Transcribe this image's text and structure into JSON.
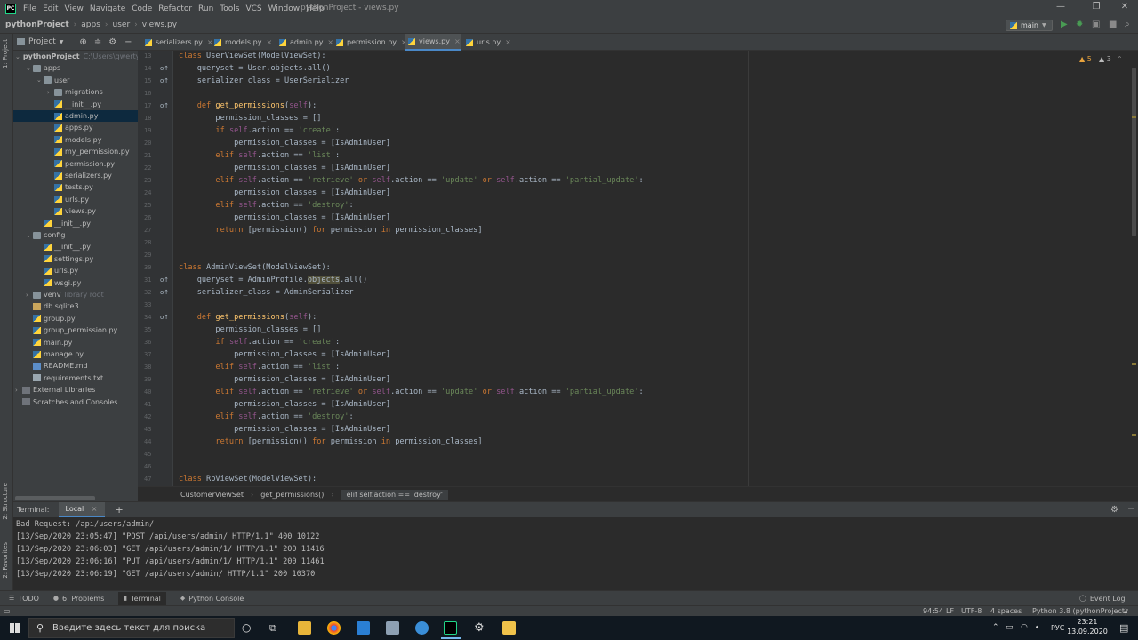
{
  "menubar": {
    "logo": "PC",
    "items": [
      "File",
      "Edit",
      "View",
      "Navigate",
      "Code",
      "Refactor",
      "Run",
      "Tools",
      "VCS",
      "Window",
      "Help"
    ],
    "window_title": "pythonProject - views.py",
    "window_controls": [
      "—",
      "❐",
      "✕"
    ]
  },
  "navbar": {
    "breadcrumbs": [
      "pythonProject",
      "apps",
      "user",
      "views.py"
    ],
    "branch": "main"
  },
  "left_strip": {
    "project_label": "1: Project",
    "structure_label": "2: Structure",
    "favorites_label": "2: Favorites"
  },
  "project_panel": {
    "title": "Project",
    "tree": [
      {
        "label": "pythonProject",
        "hint": "C:\\Users\\qwerty",
        "indent": 0,
        "type": "folder",
        "arrow": "⌄",
        "bold": true
      },
      {
        "label": "apps",
        "indent": 1,
        "type": "folder",
        "arrow": "⌄"
      },
      {
        "label": "user",
        "indent": 2,
        "type": "folder",
        "arrow": "⌄"
      },
      {
        "label": "migrations",
        "indent": 3,
        "type": "folder",
        "arrow": "›"
      },
      {
        "label": "__init__.py",
        "indent": 3,
        "type": "py"
      },
      {
        "label": "admin.py",
        "indent": 3,
        "type": "py",
        "selected": true
      },
      {
        "label": "apps.py",
        "indent": 3,
        "type": "py"
      },
      {
        "label": "models.py",
        "indent": 3,
        "type": "py"
      },
      {
        "label": "my_permission.py",
        "indent": 3,
        "type": "py"
      },
      {
        "label": "permission.py",
        "indent": 3,
        "type": "py"
      },
      {
        "label": "serializers.py",
        "indent": 3,
        "type": "py"
      },
      {
        "label": "tests.py",
        "indent": 3,
        "type": "py"
      },
      {
        "label": "urls.py",
        "indent": 3,
        "type": "py"
      },
      {
        "label": "views.py",
        "indent": 3,
        "type": "py"
      },
      {
        "label": "__init__.py",
        "indent": 2,
        "type": "py"
      },
      {
        "label": "config",
        "indent": 1,
        "type": "folder",
        "arrow": "⌄"
      },
      {
        "label": "__init__.py",
        "indent": 2,
        "type": "py"
      },
      {
        "label": "settings.py",
        "indent": 2,
        "type": "py"
      },
      {
        "label": "urls.py",
        "indent": 2,
        "type": "py"
      },
      {
        "label": "wsgi.py",
        "indent": 2,
        "type": "py"
      },
      {
        "label": "venv",
        "hint": "library root",
        "indent": 1,
        "type": "folder",
        "arrow": "›"
      },
      {
        "label": "db.sqlite3",
        "indent": 1,
        "type": "db"
      },
      {
        "label": "group.py",
        "indent": 1,
        "type": "py"
      },
      {
        "label": "group_permission.py",
        "indent": 1,
        "type": "py"
      },
      {
        "label": "main.py",
        "indent": 1,
        "type": "py"
      },
      {
        "label": "manage.py",
        "indent": 1,
        "type": "py"
      },
      {
        "label": "README.md",
        "indent": 1,
        "type": "md"
      },
      {
        "label": "requirements.txt",
        "indent": 1,
        "type": "file"
      },
      {
        "label": "External Libraries",
        "indent": 0,
        "type": "lib",
        "arrow": "›"
      },
      {
        "label": "Scratches and Consoles",
        "indent": 0,
        "type": "lib"
      }
    ]
  },
  "tabs": [
    {
      "label": "serializers.py"
    },
    {
      "label": "models.py"
    },
    {
      "label": "admin.py"
    },
    {
      "label": "permission.py"
    },
    {
      "label": "views.py",
      "active": true
    },
    {
      "label": "urls.py"
    }
  ],
  "editor": {
    "inspections": {
      "warnings": "5",
      "weak_warnings": "3"
    },
    "lines": [
      {
        "n": "13",
        "marker": "",
        "html": "<span class=\"kw\">class </span>UserViewSet(ModelViewSet):"
      },
      {
        "n": "14",
        "marker": "o↑",
        "html": "    queryset = User.objects.all()"
      },
      {
        "n": "15",
        "marker": "o↑",
        "html": "    serializer_class = UserSerializer"
      },
      {
        "n": "16",
        "marker": "",
        "html": ""
      },
      {
        "n": "17",
        "marker": "o↑",
        "html": "    <span class=\"kw\">def </span><span class=\"fn\">get_permissions</span>(<span class=\"self\">self</span>):"
      },
      {
        "n": "18",
        "marker": "",
        "html": "        permission_classes = []"
      },
      {
        "n": "19",
        "marker": "",
        "html": "        <span class=\"kw\">if </span><span class=\"self\">self</span>.action == <span class=\"str\">'create'</span>:"
      },
      {
        "n": "20",
        "marker": "",
        "html": "            permission_classes = [IsAdminUser]"
      },
      {
        "n": "21",
        "marker": "",
        "html": "        <span class=\"kw\">elif </span><span class=\"self\">self</span>.action == <span class=\"str\">'list'</span>:"
      },
      {
        "n": "22",
        "marker": "",
        "html": "            permission_classes = [IsAdminUser]"
      },
      {
        "n": "23",
        "marker": "",
        "html": "        <span class=\"kw\">elif </span><span class=\"self\">self</span>.action == <span class=\"str\">'retrieve'</span> <span class=\"kw\">or </span><span class=\"self\">self</span>.action == <span class=\"str\">'update'</span> <span class=\"kw\">or </span><span class=\"self\">self</span>.action == <span class=\"str\">'partial_update'</span>:"
      },
      {
        "n": "24",
        "marker": "",
        "html": "            permission_classes = [IsAdminUser]"
      },
      {
        "n": "25",
        "marker": "",
        "html": "        <span class=\"kw\">elif </span><span class=\"self\">self</span>.action == <span class=\"str\">'destroy'</span>:"
      },
      {
        "n": "26",
        "marker": "",
        "html": "            permission_classes = [IsAdminUser]"
      },
      {
        "n": "27",
        "marker": "",
        "html": "        <span class=\"kw\">return </span>[permission() <span class=\"kw\">for </span>permission <span class=\"kw\">in </span>permission_classes]"
      },
      {
        "n": "28",
        "marker": "",
        "html": ""
      },
      {
        "n": "29",
        "marker": "",
        "html": ""
      },
      {
        "n": "30",
        "marker": "",
        "html": "<span class=\"kw\">class </span>AdminViewSet(ModelViewSet):"
      },
      {
        "n": "31",
        "marker": "o↑",
        "html": "    queryset = AdminProfile.<span class=\"hl\">objects</span>.all()"
      },
      {
        "n": "32",
        "marker": "o↑",
        "html": "    serializer_class = AdminSerializer"
      },
      {
        "n": "33",
        "marker": "",
        "html": ""
      },
      {
        "n": "34",
        "marker": "o↑",
        "html": "    <span class=\"kw\">def </span><span class=\"fn\">get_permissions</span>(<span class=\"self\">self</span>):"
      },
      {
        "n": "35",
        "marker": "",
        "html": "        permission_classes = []"
      },
      {
        "n": "36",
        "marker": "",
        "html": "        <span class=\"kw\">if </span><span class=\"self\">self</span>.action == <span class=\"str\">'create'</span>:"
      },
      {
        "n": "37",
        "marker": "",
        "html": "            permission_classes = [IsAdminUser]"
      },
      {
        "n": "38",
        "marker": "",
        "html": "        <span class=\"kw\">elif </span><span class=\"self\">self</span>.action == <span class=\"str\">'list'</span>:"
      },
      {
        "n": "39",
        "marker": "",
        "html": "            permission_classes = [IsAdminUser]"
      },
      {
        "n": "40",
        "marker": "",
        "html": "        <span class=\"kw\">elif </span><span class=\"self\">self</span>.action == <span class=\"str\">'retrieve'</span> <span class=\"kw\">or </span><span class=\"self\">self</span>.action == <span class=\"str\">'update'</span> <span class=\"kw\">or </span><span class=\"self\">self</span>.action == <span class=\"str\">'partial_update'</span>:"
      },
      {
        "n": "41",
        "marker": "",
        "html": "            permission_classes = [IsAdminUser]"
      },
      {
        "n": "42",
        "marker": "",
        "html": "        <span class=\"kw\">elif </span><span class=\"self\">self</span>.action == <span class=\"str\">'destroy'</span>:"
      },
      {
        "n": "43",
        "marker": "",
        "html": "            permission_classes = [IsAdminUser]"
      },
      {
        "n": "44",
        "marker": "",
        "html": "        <span class=\"kw\">return </span>[permission() <span class=\"kw\">for </span>permission <span class=\"kw\">in </span>permission_classes]"
      },
      {
        "n": "45",
        "marker": "",
        "html": ""
      },
      {
        "n": "46",
        "marker": "",
        "html": ""
      },
      {
        "n": "47",
        "marker": "",
        "html": "<span class=\"kw\">class </span>RpViewSet(ModelViewSet):"
      }
    ]
  },
  "code_breadcrumb": [
    "CustomerViewSet",
    "get_permissions()",
    "elif self.action == 'destroy'"
  ],
  "terminal": {
    "label": "Terminal:",
    "tab": "Local",
    "close": "×",
    "add": "+",
    "lines": [
      "Bad Request: /api/users/admin/",
      "[13/Sep/2020 23:05:47] \"POST /api/users/admin/ HTTP/1.1\" 400 10122",
      "[13/Sep/2020 23:06:03] \"GET /api/users/admin/1/ HTTP/1.1\" 200 11416",
      "[13/Sep/2020 23:06:16] \"PUT /api/users/admin/1/ HTTP/1.1\" 200 11461",
      "[13/Sep/2020 23:06:19] \"GET /api/users/admin/ HTTP/1.1\" 200 10370"
    ]
  },
  "bottom_tools": {
    "todo": "TODO",
    "problems": "6: Problems",
    "terminal": "Terminal",
    "python_console": "Python Console",
    "event_log": "Event Log"
  },
  "statusbar": {
    "position": "94:54",
    "line_sep": "LF",
    "encoding": "UTF-8",
    "indent": "4 spaces",
    "interpreter": "Python 3.8 (pythonProject)"
  },
  "taskbar": {
    "search_placeholder": "Введите здесь текст для поиска",
    "lang": "РУС",
    "time": "23:21",
    "date": "13.09.2020"
  },
  "colors": {
    "keyword": "#cc7832",
    "function": "#ffc66d",
    "string": "#6a8759",
    "self": "#94558d",
    "selection": "#0d293e",
    "accent": "#4a88c7"
  }
}
